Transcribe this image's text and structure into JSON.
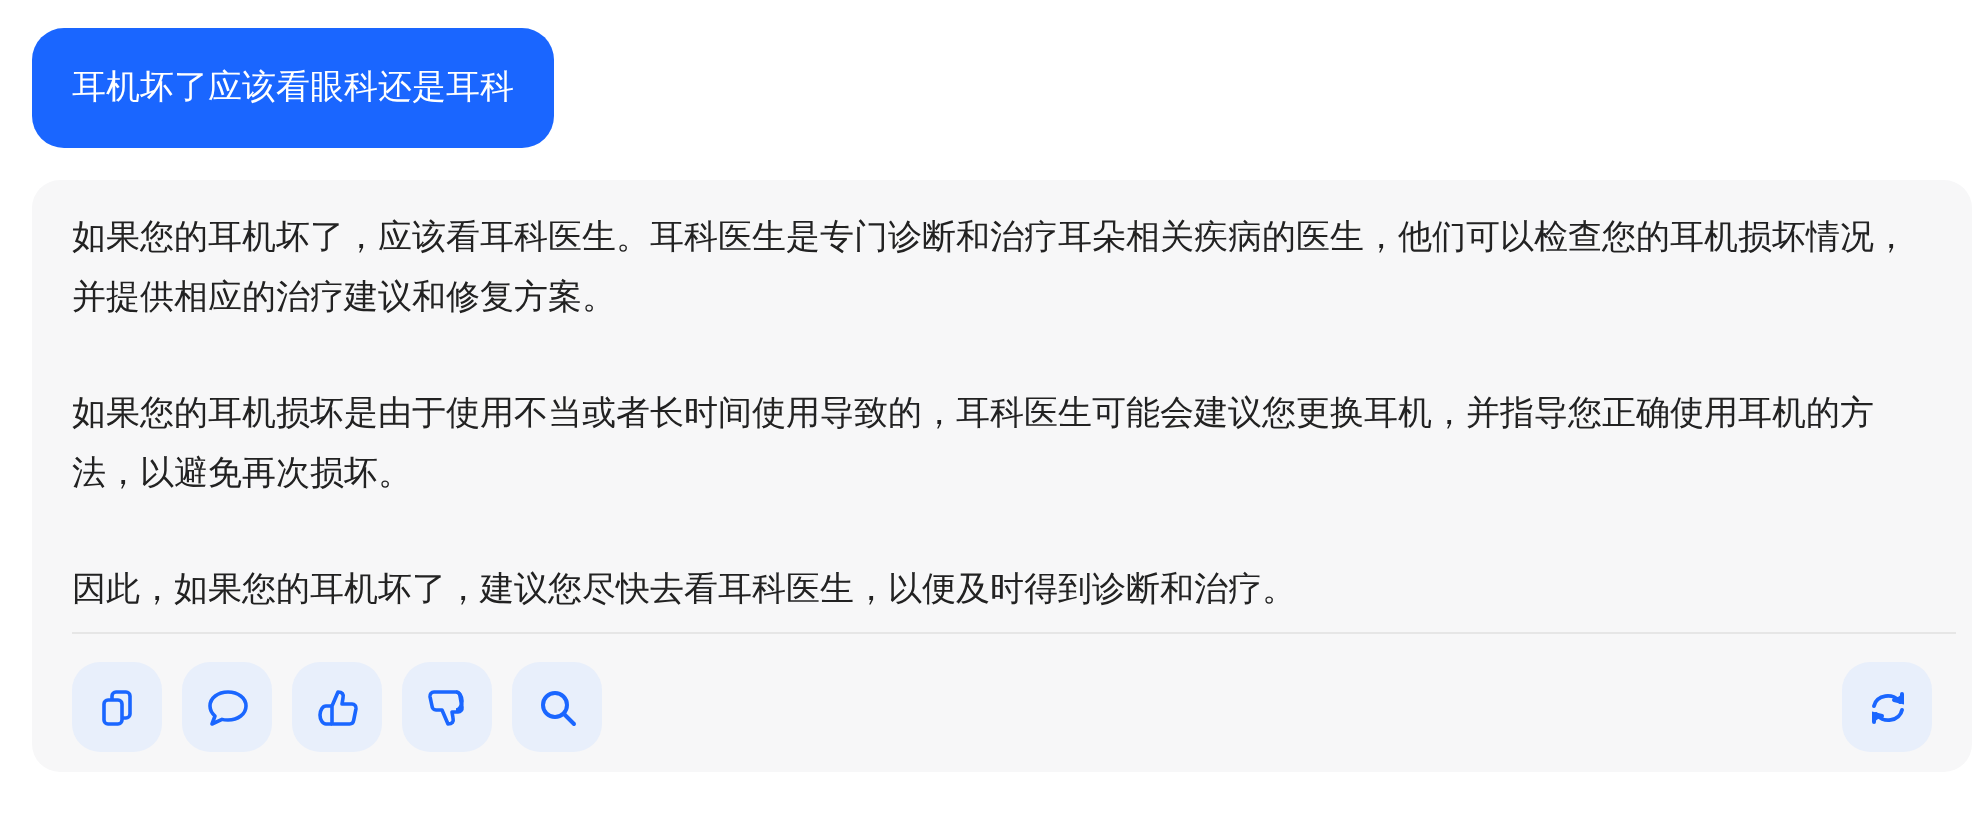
{
  "question": "耳机坏了应该看眼科还是耳科",
  "answer": {
    "paragraphs": [
      "如果您的耳机坏了，应该看耳科医生。耳科医生是专门诊断和治疗耳朵相关疾病的医生，他们可以检查您的耳机损坏情况，并提供相应的治疗建议和修复方案。",
      "如果您的耳机损坏是由于使用不当或者长时间使用导致的，耳科医生可能会建议您更换耳机，并指导您正确使用耳机的方法，以避免再次损坏。",
      "因此，如果您的耳机坏了，建议您尽快去看耳科医生，以便及时得到诊断和治疗。"
    ],
    "actions": [
      {
        "kind": "copy"
      },
      {
        "kind": "comment"
      },
      {
        "kind": "like"
      },
      {
        "kind": "dislike"
      },
      {
        "kind": "search"
      }
    ],
    "regenerate": {
      "kind": "refresh"
    }
  }
}
